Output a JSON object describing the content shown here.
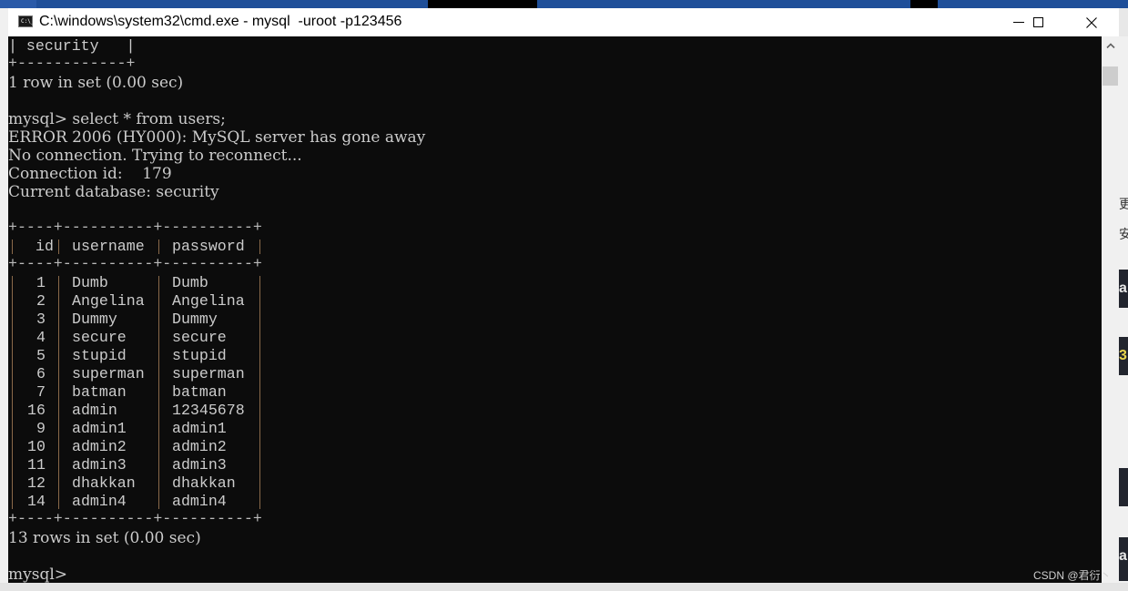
{
  "window": {
    "title": "C:\\windows\\system32\\cmd.exe - mysql  -uroot -p123456",
    "icon": "cmd-icon",
    "icon_text": "C:\\_",
    "controls": {
      "minimize": "minimize-icon",
      "maximize": "maximize-icon",
      "close": "close-icon"
    }
  },
  "console": {
    "prev_output": {
      "db_row": "| security   |",
      "border": "+------------+",
      "summary": "1 row in set (0.00 sec)"
    },
    "command": {
      "prompt": "mysql>",
      "query": "select * from users;"
    },
    "messages": [
      "ERROR 2006 (HY000): MySQL server has gone away",
      "No connection. Trying to reconnect...",
      "Connection id:    179",
      "Current database: security"
    ],
    "table": {
      "border": "+----+----------+----------+",
      "columns": [
        "id",
        "username",
        "password"
      ],
      "rows": [
        {
          "id": "1",
          "username": "Dumb",
          "password": "Dumb"
        },
        {
          "id": "2",
          "username": "Angelina",
          "password": "Angelina"
        },
        {
          "id": "3",
          "username": "Dummy",
          "password": "Dummy"
        },
        {
          "id": "4",
          "username": "secure",
          "password": "secure"
        },
        {
          "id": "5",
          "username": "stupid",
          "password": "stupid"
        },
        {
          "id": "6",
          "username": "superman",
          "password": "superman"
        },
        {
          "id": "7",
          "username": "batman",
          "password": "batman"
        },
        {
          "id": "16",
          "username": "admin",
          "password": "12345678"
        },
        {
          "id": "9",
          "username": "admin1",
          "password": "admin1"
        },
        {
          "id": "10",
          "username": "admin2",
          "password": "admin2"
        },
        {
          "id": "11",
          "username": "admin3",
          "password": "admin3"
        },
        {
          "id": "12",
          "username": "dhakkan",
          "password": "dhakkan"
        },
        {
          "id": "14",
          "username": "admin4",
          "password": "admin4"
        }
      ],
      "summary": "13 rows in set (0.00 sec)"
    },
    "final_prompt": "mysql>"
  },
  "scrollbar": {
    "up_icon": "chevron-up-icon"
  },
  "watermark": "CSDN @君衍丶",
  "background_fragments": {
    "right": [
      "更",
      "安",
      "a",
      "3",
      "a"
    ]
  },
  "colors": {
    "console_bg": "#0c0c0c",
    "console_text": "#cccccc",
    "titlebar_bg": "#ffffff",
    "scrollbar_bg": "#f0f0f0"
  }
}
